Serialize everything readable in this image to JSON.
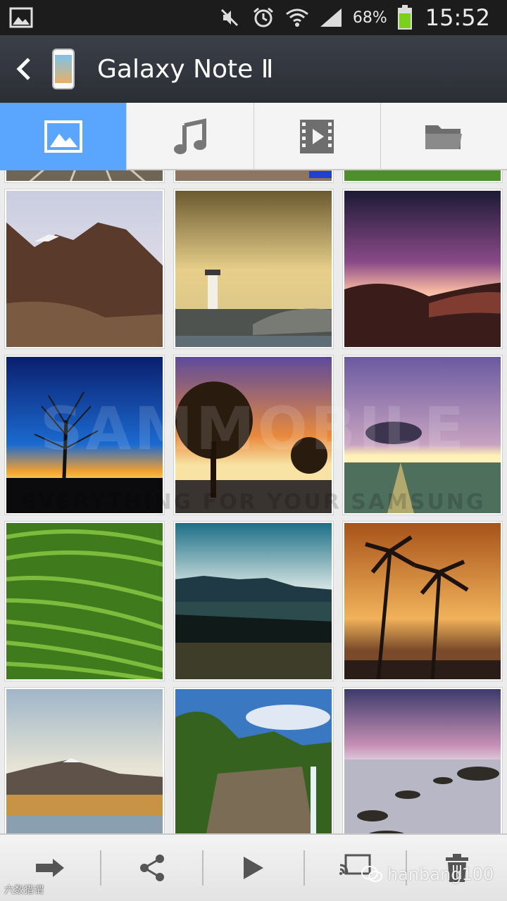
{
  "status_bar": {
    "battery_percent": "68%",
    "time": "15:52",
    "icons": [
      "gallery-notification-icon",
      "mute-icon",
      "alarm-icon",
      "wifi-icon",
      "signal-icon",
      "battery-icon"
    ]
  },
  "action_bar": {
    "title": "Galaxy Note Ⅱ",
    "back_icon": "chevron-left-icon",
    "device_icon": "phone-device-icon"
  },
  "tabs": [
    {
      "icon": "image-icon",
      "active": true
    },
    {
      "icon": "music-note-icon",
      "active": false
    },
    {
      "icon": "video-film-icon",
      "active": false
    },
    {
      "icon": "folder-icon",
      "active": false
    }
  ],
  "gallery": {
    "thumbnails": [
      "rail-tracks",
      "road-dusk",
      "green-field",
      "highland-mountains",
      "lighthouse-pier",
      "purple-sunset-hills",
      "bare-tree-sunset",
      "park-trees-sunset",
      "ocean-sunset-clouds",
      "tea-plantation",
      "mountain-lake-reflection",
      "palm-trees-sunset",
      "snowy-mountain-lake",
      "waterfall-cliffs",
      "rocky-shore-dusk"
    ]
  },
  "watermarks": {
    "brand": "SAMMOBILE",
    "tagline": "EVERYTHING FOR YOUR SAMSUNG",
    "credit": "hanbang100",
    "credit_icon": "chat-bubble-icon",
    "logo": "六数猎谓"
  },
  "bottom_bar": [
    {
      "icon": "forward-arrow-icon"
    },
    {
      "icon": "share-icon"
    },
    {
      "icon": "play-icon"
    },
    {
      "icon": "screen-mirror-icon"
    },
    {
      "icon": "trash-icon"
    }
  ],
  "colors": {
    "status_bar": "#1c1c1c",
    "action_bar": "#2f333a",
    "active_tab": "#5aa6ff",
    "battery_fill": "#7bd11a"
  }
}
